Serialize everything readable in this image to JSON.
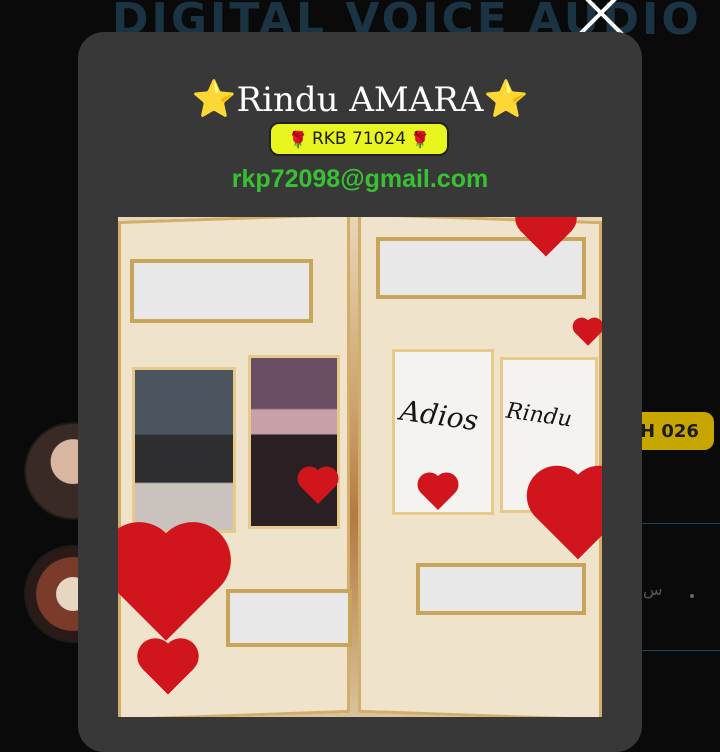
{
  "background": {
    "app_title": "DIGITAL VOICE AUDIO",
    "badge_text": "H 026"
  },
  "modal": {
    "title_name": "Rindu AMARA",
    "title_star_left": "⭐",
    "title_star_right": "⭐",
    "tag_text": "RKB 71024",
    "tag_rose": "🌹",
    "email": "rkp72098@gmail.com",
    "photo_script_left": "Adios",
    "photo_script_right": "Rindu"
  },
  "colors": {
    "modal_bg": "#383838",
    "tag_bg": "#e9f51e",
    "email": "#38c233",
    "badge_bg": "#c8a600"
  },
  "icons": [
    "close-icon",
    "star-icon",
    "rose-icon"
  ]
}
